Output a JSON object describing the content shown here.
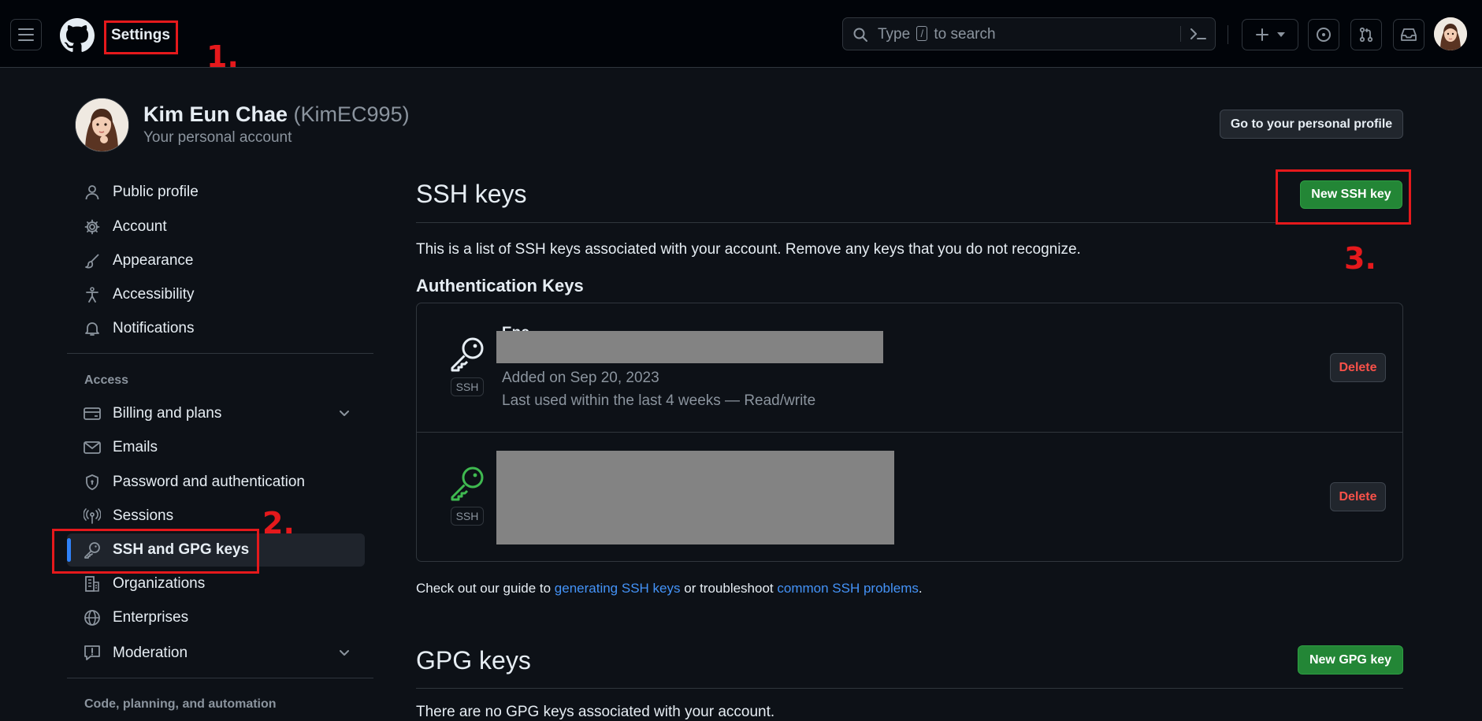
{
  "header": {
    "context_title": "Settings",
    "search": {
      "prefix": "Type",
      "key": "/",
      "suffix": "to search"
    },
    "plus_icon": "plus-icon",
    "has_notification": true
  },
  "profile": {
    "name": "Kim Eun Chae",
    "handle": "(KimEC995)",
    "subtitle": "Your personal account",
    "profile_button": "Go to your personal profile"
  },
  "sidebar": {
    "items": [
      {
        "label": "Public profile",
        "icon": "person-icon"
      },
      {
        "label": "Account",
        "icon": "gear-icon"
      },
      {
        "label": "Appearance",
        "icon": "paintbrush-icon"
      },
      {
        "label": "Accessibility",
        "icon": "accessibility-icon"
      },
      {
        "label": "Notifications",
        "icon": "bell-icon"
      }
    ],
    "access_heading": "Access",
    "access_items": [
      {
        "label": "Billing and plans",
        "icon": "credit-card-icon"
      },
      {
        "label": "Emails",
        "icon": "mail-icon"
      },
      {
        "label": "Password and authentication",
        "icon": "shield-lock-icon"
      },
      {
        "label": "Sessions",
        "icon": "broadcast-icon"
      },
      {
        "label": "SSH and GPG keys",
        "icon": "key-icon"
      },
      {
        "label": "Organizations",
        "icon": "organization-icon"
      },
      {
        "label": "Enterprises",
        "icon": "globe-icon"
      },
      {
        "label": "Moderation",
        "icon": "report-icon"
      }
    ],
    "code_heading": "Code, planning, and automation"
  },
  "main": {
    "ssh_title": "SSH keys",
    "new_ssh_button": "New SSH key",
    "intro": "This is a list of SSH keys associated with your account. Remove any keys that you do not recognize.",
    "auth_heading": "Authentication Keys",
    "keys": [
      {
        "title": "Enc...",
        "type": "SSH",
        "added": "Added on Sep 20, 2023",
        "last_used": "Last used within the last 4 weeks — Read/write",
        "delete_label": "Delete",
        "key_color": "#e6edf3"
      },
      {
        "type": "SSH",
        "delete_label": "Delete",
        "key_color": "#3fb950"
      }
    ],
    "guide": {
      "before": "Check out our guide to",
      "link1": "generating SSH keys",
      "middle": "or troubleshoot",
      "link2": "common SSH problems",
      "after": "."
    },
    "gpg_title": "GPG keys",
    "new_gpg_button": "New GPG key",
    "gpg_intro_partial": "There are no GPG keys associated with your account."
  },
  "annotations": {
    "one": "1.",
    "two": "2.",
    "three": "3."
  },
  "colors": {
    "annotation": "#e5191c",
    "accent": "#2f81f7",
    "green": "#238636",
    "danger": "#f85149"
  }
}
